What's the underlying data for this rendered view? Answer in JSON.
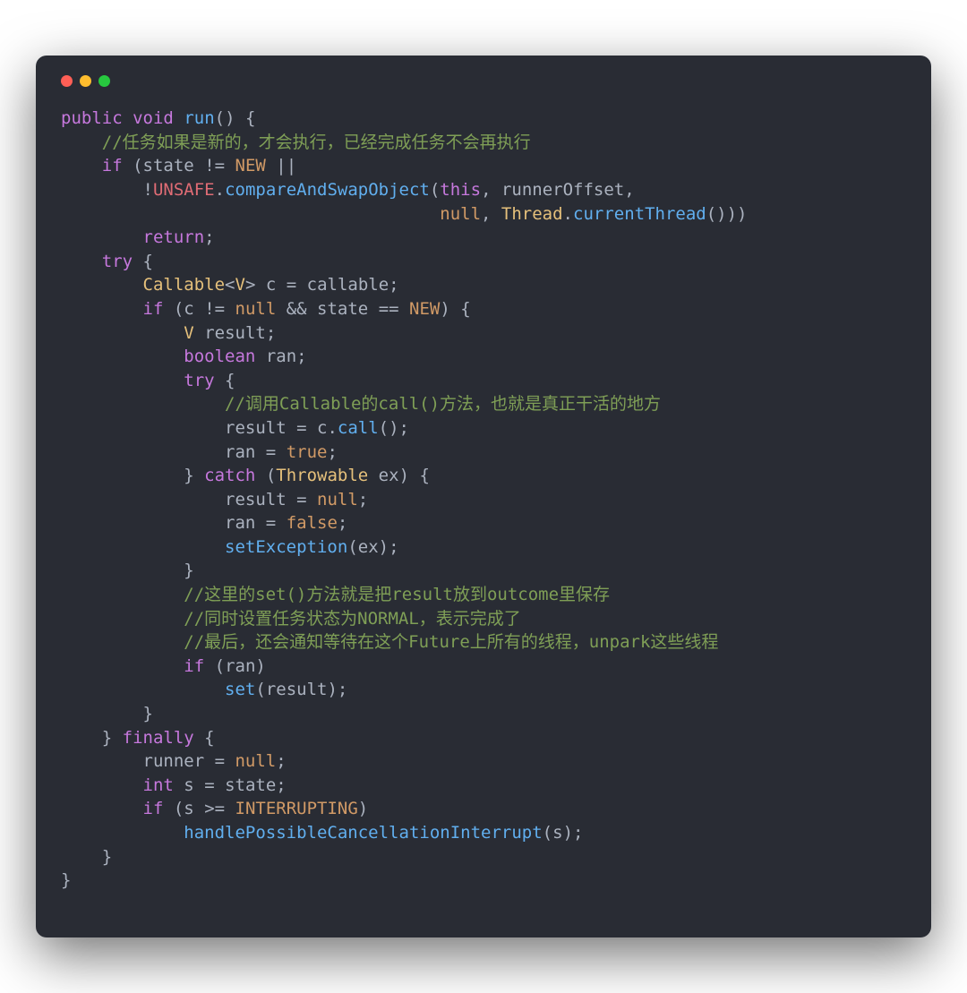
{
  "window": {
    "dots": [
      "red",
      "yellow",
      "green"
    ]
  },
  "code": {
    "l1": {
      "kw1": "public",
      "kw2": "void",
      "fn": "run",
      "p": "() {"
    },
    "l2": {
      "cmt": "//任务如果是新的，才会执行，已经完成任务不会再执行"
    },
    "l3": {
      "kw": "if",
      "p1": " (",
      "v": "state",
      "op": " != ",
      "c": "NEW",
      "op2": " ||"
    },
    "l4": {
      "neg": "!",
      "cls": "UNSAFE",
      "dot": ".",
      "fn": "compareAndSwapObject",
      "p1": "(",
      "kw": "this",
      "c1": ", ",
      "v1": "runnerOffset",
      "c2": ","
    },
    "l5": {
      "n": "null",
      "c1": ", ",
      "cls": "Thread",
      "dot": ".",
      "fn": "currentThread",
      "p": "()))"
    },
    "l6": {
      "kw": "return",
      "p": ";"
    },
    "l7": {
      "kw": "try",
      "p": " {"
    },
    "l8": {
      "cls": "Callable",
      "lt": "<",
      "tp": "V",
      "gt": ">",
      "sp": " ",
      "v1": "c",
      "eq": " = ",
      "v2": "callable",
      "p": ";"
    },
    "l9": {
      "kw": "if",
      "p1": " (",
      "v1": "c",
      "op1": " != ",
      "n": "null",
      "op2": " && ",
      "v2": "state",
      "op3": " == ",
      "c": "NEW",
      "p2": ") {"
    },
    "l10": {
      "cls": "V",
      "sp": " ",
      "v": "result",
      "p": ";"
    },
    "l11": {
      "t": "boolean",
      "sp": " ",
      "v": "ran",
      "p": ";"
    },
    "l12": {
      "kw": "try",
      "p": " {"
    },
    "l13": {
      "cmt": "//调用Callable的call()方法，也就是真正干活的地方"
    },
    "l14": {
      "v1": "result",
      "eq": " = ",
      "v2": "c",
      "dot": ".",
      "fn": "call",
      "p": "();"
    },
    "l15": {
      "v": "ran",
      "eq": " = ",
      "c": "true",
      "p": ";"
    },
    "l16": {
      "p1": "} ",
      "kw": "catch",
      "p2": " (",
      "cls": "Throwable",
      "sp": " ",
      "v": "ex",
      "p3": ") {"
    },
    "l17": {
      "v": "result",
      "eq": " = ",
      "n": "null",
      "p": ";"
    },
    "l18": {
      "v": "ran",
      "eq": " = ",
      "c": "false",
      "p": ";"
    },
    "l19": {
      "fn": "setException",
      "p1": "(",
      "v": "ex",
      "p2": ");"
    },
    "l20": {
      "p": "}"
    },
    "l21": {
      "cmt": "//这里的set()方法就是把result放到outcome里保存"
    },
    "l22": {
      "cmt": "//同时设置任务状态为NORMAL，表示完成了"
    },
    "l23": {
      "cmt": "//最后，还会通知等待在这个Future上所有的线程，unpark这些线程"
    },
    "l24": {
      "kw": "if",
      "p1": " (",
      "v": "ran",
      "p2": ")"
    },
    "l25": {
      "fn": "set",
      "p1": "(",
      "v": "result",
      "p2": ");"
    },
    "l26": {
      "p": "}"
    },
    "l27": {
      "p1": "} ",
      "kw": "finally",
      "p2": " {"
    },
    "l28": {
      "v": "runner",
      "eq": " = ",
      "n": "null",
      "p": ";"
    },
    "l29": {
      "t": "int",
      "sp": " ",
      "v1": "s",
      "eq": " = ",
      "v2": "state",
      "p": ";"
    },
    "l30": {
      "kw": "if",
      "p1": " (",
      "v": "s",
      "op": " >= ",
      "c": "INTERRUPTING",
      "p2": ")"
    },
    "l31": {
      "fn": "handlePossibleCancellationInterrupt",
      "p1": "(",
      "v": "s",
      "p2": ");"
    },
    "l32": {
      "p": "}"
    },
    "l33": {
      "p": "}"
    }
  }
}
